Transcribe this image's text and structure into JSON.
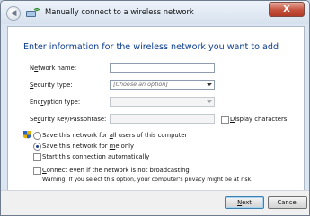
{
  "window": {
    "title": "Manually connect to a wireless network",
    "close_label": "X"
  },
  "heading": "Enter information for the wireless network you want to add",
  "form": {
    "network_name": {
      "label_pre": "N",
      "label_underlined": "e",
      "label_post": "twork name:",
      "value": ""
    },
    "security_type": {
      "label_underlined": "S",
      "label_post": "ecurity type:",
      "value": "[Choose an option]"
    },
    "encryption_type": {
      "label_pre": "Enc",
      "label_underlined": "r",
      "label_post": "yption type:",
      "value": ""
    },
    "security_key": {
      "label_pre": "Se",
      "label_underlined": "c",
      "label_post": "urity Key/Passphrase:",
      "value": ""
    },
    "display_characters": {
      "label_underlined": "D",
      "label_post": "isplay characters",
      "checked": false
    }
  },
  "save_options": {
    "all_users": {
      "label_pre": "Save this network for ",
      "label_underlined": "a",
      "label_post": "ll users of this computer",
      "selected": false
    },
    "me_only": {
      "label_pre": "Save this network for ",
      "label_underlined": "m",
      "label_post": "e only",
      "selected": true
    }
  },
  "options": {
    "start_auto": {
      "label_underlined": "S",
      "label_post": "tart this connection automatically",
      "checked": false
    },
    "connect_not_broadcasting": {
      "label_underlined": "C",
      "label_post": "onnect even if the network is not broadcasting",
      "checked": false
    },
    "warning": "Warning: If you select this option, your computer's privacy might be at risk."
  },
  "buttons": {
    "next_underlined": "N",
    "next_post": "ext",
    "cancel": "Cancel"
  },
  "colors": {
    "heading": "#0a3c8c",
    "titlebar": "#dce6f2",
    "close": "#c4503b"
  }
}
